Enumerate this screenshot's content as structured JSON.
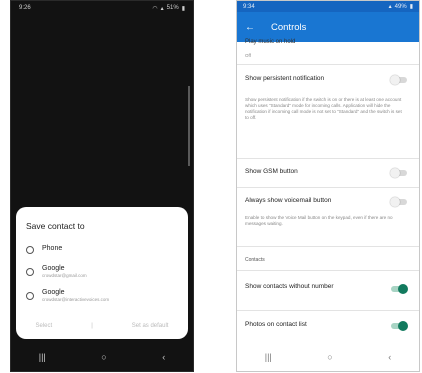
{
  "left_phone": {
    "status_bar": {
      "time": "9:26",
      "battery": "51%"
    },
    "dialog": {
      "title": "Save contact to",
      "options": [
        {
          "name": "Phone",
          "sub": ""
        },
        {
          "name": "Google",
          "sub": "crowdstar@gmail.com"
        },
        {
          "name": "Google",
          "sub": "crowdstar@interactivevoices.com"
        }
      ],
      "select_label": "Select",
      "set_default_label": "Set as default"
    },
    "nav": {
      "recents": "|||",
      "home": "○",
      "back": "‹"
    }
  },
  "right_phone": {
    "status_bar": {
      "time": "9:34",
      "battery": "49%"
    },
    "app_bar": {
      "back": "←",
      "title": "Controls"
    },
    "partial_row": {
      "title": "Play music on hold",
      "value": "Off"
    },
    "rows": {
      "persistent_notification": {
        "title": "Show persistent notification",
        "desc": "Show persistent notification if the switch is on or there is at least one account which uses \"Standard\" mode for incoming calls. Application will hide the notification if incoming call mode is not set to \"Standard\" and the switch is set to off."
      },
      "gsm_button": {
        "title": "Show GSM button"
      },
      "voicemail_button": {
        "title": "Always show voicemail button",
        "desc": "Enable to show the Voice Mail button on the keypad, even if there are no messages waiting."
      },
      "contacts_header": "Contacts",
      "contacts_without_number": {
        "title": "Show contacts without number"
      },
      "photos_on_list": {
        "title": "Photos on contact list"
      }
    },
    "toggles": {
      "persistent_notification": false,
      "gsm_button": false,
      "voicemail_button": false,
      "contacts_without_number": true,
      "photos_on_list": true
    },
    "nav": {
      "recents": "|||",
      "home": "○",
      "back": "‹"
    }
  }
}
